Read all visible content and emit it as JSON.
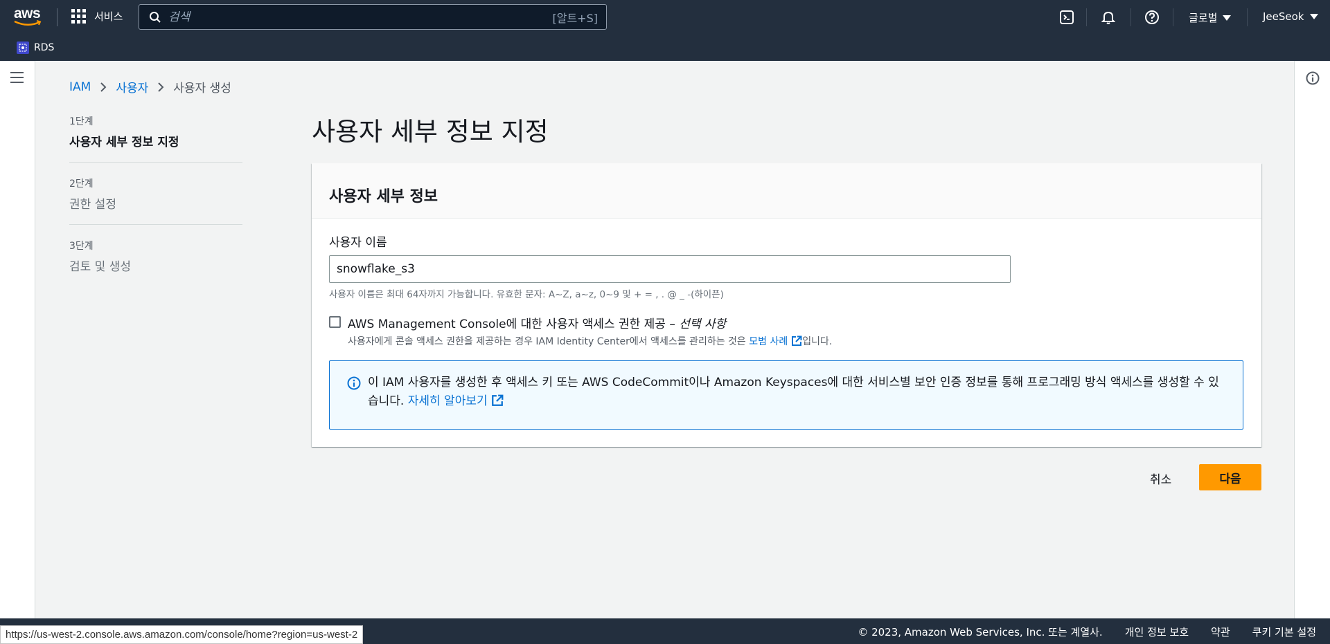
{
  "topnav": {
    "logo_text": "aws",
    "services_label": "서비스",
    "search_placeholder": "검색",
    "search_shortcut": "[알트+S]",
    "region_label": "글로벌",
    "user_label": "JeeSeok"
  },
  "favorites": {
    "rds_label": "RDS"
  },
  "breadcrumb": {
    "root": "IAM",
    "parent": "사용자",
    "current": "사용자 생성"
  },
  "steps": [
    {
      "num": "1단계",
      "name": "사용자 세부 정보 지정"
    },
    {
      "num": "2단계",
      "name": "권한 설정"
    },
    {
      "num": "3단계",
      "name": "검토 및 생성"
    }
  ],
  "page": {
    "title": "사용자 세부 정보 지정"
  },
  "card": {
    "header": "사용자 세부 정보",
    "username_label": "사용자 이름",
    "username_value": "snowflake_s3",
    "username_hint": "사용자 이름은 최대 64자까지 가능합니다. 유효한 문자: A~Z, a~z, 0~9 및 + = , . @ _ -(하이픈)",
    "console_access_label": "AWS Management Console에 대한 사용자 액세스 권한 제공 –",
    "console_access_optional": "선택 사항",
    "console_access_desc": "사용자에게 콘솔 액세스 권한을 제공하는 경우 IAM Identity Center에서 액세스를 관리하는 것은",
    "console_access_link": "모범 사례",
    "console_access_suffix": "입니다.",
    "alert_text": "이 IAM 사용자를 생성한 후 액세스 키 또는 AWS CodeCommit이나 Amazon Keyspaces에 대한 서비스별 보안 인증 정보를 통해 프로그래밍 방식 액세스를 생성할 수 있습니다.",
    "alert_link": "자세히 알아보기"
  },
  "actions": {
    "cancel": "취소",
    "next": "다음"
  },
  "footer": {
    "copyright": "© 2023, Amazon Web Services, Inc. 또는 계열사.",
    "privacy": "개인 정보 보호",
    "terms": "약관",
    "cookies": "쿠키 기본 설정"
  },
  "status_bar": {
    "url": "https://us-west-2.console.aws.amazon.com/console/home?region=us-west-2"
  },
  "colors": {
    "nav_bg": "#232f3e",
    "primary_button": "#ff9900",
    "link": "#0972d3",
    "info_bg": "#f1faff"
  }
}
